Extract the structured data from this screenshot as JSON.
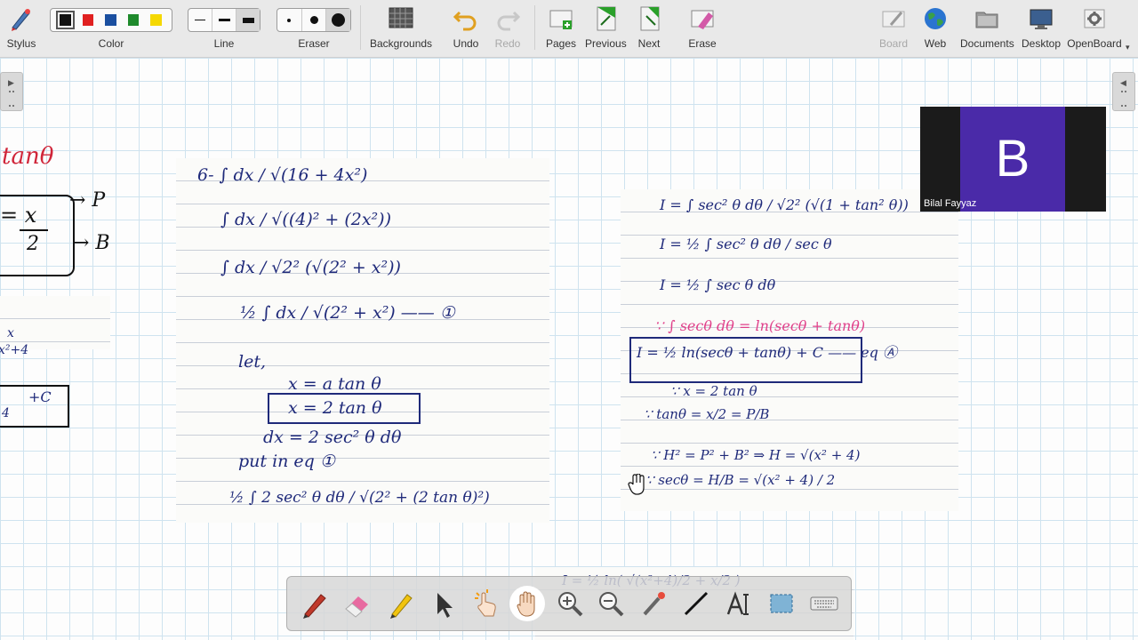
{
  "toolbar": {
    "stylus": "Stylus",
    "color": "Color",
    "line": "Line",
    "eraser": "Eraser",
    "backgrounds": "Backgrounds",
    "undo": "Undo",
    "redo": "Redo",
    "pages": "Pages",
    "previous": "Previous",
    "next": "Next",
    "erase": "Erase",
    "board": "Board",
    "web": "Web",
    "documents": "Documents",
    "desktop": "Desktop",
    "openboard": "OpenBoard",
    "colors": [
      "#111111",
      "#e02020",
      "#1a4fa0",
      "#1e8a2c",
      "#f5d800"
    ]
  },
  "board": {
    "left_fragments": {
      "tan": "tanθ",
      "eq_top": "= x",
      "eq_bottom": "2",
      "p_label": "→ P",
      "b_label": "→ B",
      "frac_top": "x",
      "frac_bottom": "x²+4",
      "plus_c": "+C",
      "four": "4"
    },
    "middle_notes": [
      "6-  ∫  dx / √(16 + 4x²)",
      "∫  dx / √((4)² + (2x²))",
      "∫  dx / √2² (√(2² + x²))",
      "½ ∫ dx / √(2² + x²)   —— ①",
      "let,",
      "x = a tan θ",
      "x = 2 tan θ",
      "dx = 2 sec² θ dθ",
      "put in eq ①",
      "½ ∫ 2 sec² θ dθ / √(2² + (2 tan θ)²)"
    ],
    "right_notes": [
      "I = ∫ sec² θ dθ / √2² (√(1 + tan² θ))",
      "I = ½ ∫ sec² θ dθ / sec θ",
      "I = ½ ∫ sec θ dθ",
      "∵ ∫ secθ dθ = ln(secθ + tanθ)",
      "I = ½ ln(secθ + tanθ) + C   —— eq Ⓐ",
      "∵ x = 2 tan θ",
      "∵ tanθ = x/2 = P/B",
      "∵ H² = P² + B²  ⇒  H = √(x² + 4)",
      "∵ secθ = H/B = √(x² + 4) / 2"
    ],
    "bottom_peek": "I = ½ ln( √(x²+4)/2 + x/2 )"
  },
  "video": {
    "initial": "B",
    "name": "Bilal Fayyaz"
  },
  "dock": {
    "tools": [
      "pen-tool",
      "eraser-tool",
      "marker-tool",
      "selector-tool",
      "interact-tool",
      "hand-tool",
      "zoom-in-tool",
      "zoom-out-tool",
      "laser-pointer-tool",
      "line-tool",
      "text-tool",
      "capture-tool",
      "keyboard-tool"
    ]
  }
}
